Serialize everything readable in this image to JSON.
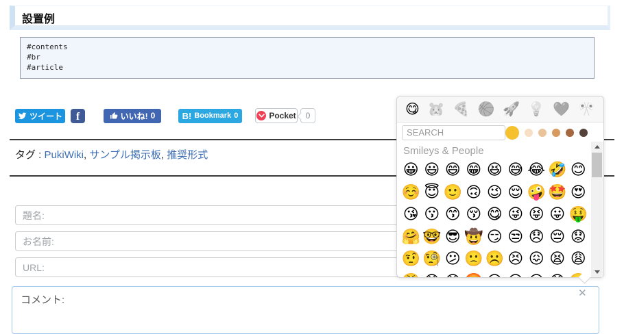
{
  "heading": {
    "title": "設置例"
  },
  "code_block": {
    "lines": [
      "#contents",
      "#br",
      "#article"
    ]
  },
  "share": {
    "tweet": {
      "label": "ツイート",
      "color": "#1b95e0"
    },
    "facebook": {
      "label": "f",
      "color": "#3f5a96"
    },
    "like": {
      "label": "いいね!",
      "count": "0",
      "color": "#4267b2"
    },
    "hatena": {
      "b_mark": "B!",
      "label": "Bookmark",
      "count": "0",
      "color": "#2ba7e1"
    },
    "pocket": {
      "label": "Pocket",
      "count": "0",
      "logo_color": "#ef4056"
    }
  },
  "tags": {
    "label": "タグ :",
    "items": [
      "PukiWiki",
      "サンプル掲示板",
      "推奨形式"
    ],
    "separator": ", ",
    "link_color": "#3d6eb4"
  },
  "form": {
    "subject": {
      "placeholder": "題名:",
      "value": ""
    },
    "name": {
      "placeholder": "お名前:",
      "value": ""
    },
    "url": {
      "placeholder": "URL:",
      "value": ""
    },
    "comment": {
      "placeholder": "コメント:",
      "value": "",
      "close_icon": "✕"
    }
  },
  "emoji_picker": {
    "categories": [
      {
        "name": "smileys-people",
        "glyph": "😋",
        "active": true
      },
      {
        "name": "animals-nature",
        "glyph": "🐹",
        "active": false
      },
      {
        "name": "food-drink",
        "glyph": "🍕",
        "active": false
      },
      {
        "name": "activity",
        "glyph": "🏀",
        "active": false
      },
      {
        "name": "travel-places",
        "glyph": "🚀",
        "active": false
      },
      {
        "name": "objects",
        "glyph": "💡",
        "active": false
      },
      {
        "name": "symbols",
        "glyph": "❤️",
        "active": false
      },
      {
        "name": "flags",
        "glyph": "🎌",
        "active": false
      }
    ],
    "search": {
      "placeholder": "SEARCH"
    },
    "skin_tones": [
      "#f5c12e",
      "#f7dfc6",
      "#eac39a",
      "#d79b62",
      "#a5673f",
      "#54423b"
    ],
    "skin_tone_selected": 0,
    "section_title": "Smileys & People",
    "emojis": [
      "😀",
      "😃",
      "😄",
      "😁",
      "😆",
      "😅",
      "😂",
      "🤣",
      "😊",
      "☺️",
      "😇",
      "🙂",
      "🙃",
      "😉",
      "😌",
      "🤪",
      "🤩",
      "😍",
      "😘",
      "😗",
      "😙",
      "😚",
      "😋",
      "😜",
      "😝",
      "😛",
      "🤑",
      "🤗",
      "🤓",
      "😎",
      "🤠",
      "😏",
      "😒",
      "😞",
      "😔",
      "😟",
      "🤨",
      "🧐",
      "😕",
      "🙁",
      "☹️",
      "😣",
      "😖",
      "😫",
      "😩",
      "😤",
      "😠",
      "😡",
      "🤬",
      "😶",
      "😐",
      "😑",
      "😯",
      "🙄"
    ]
  }
}
